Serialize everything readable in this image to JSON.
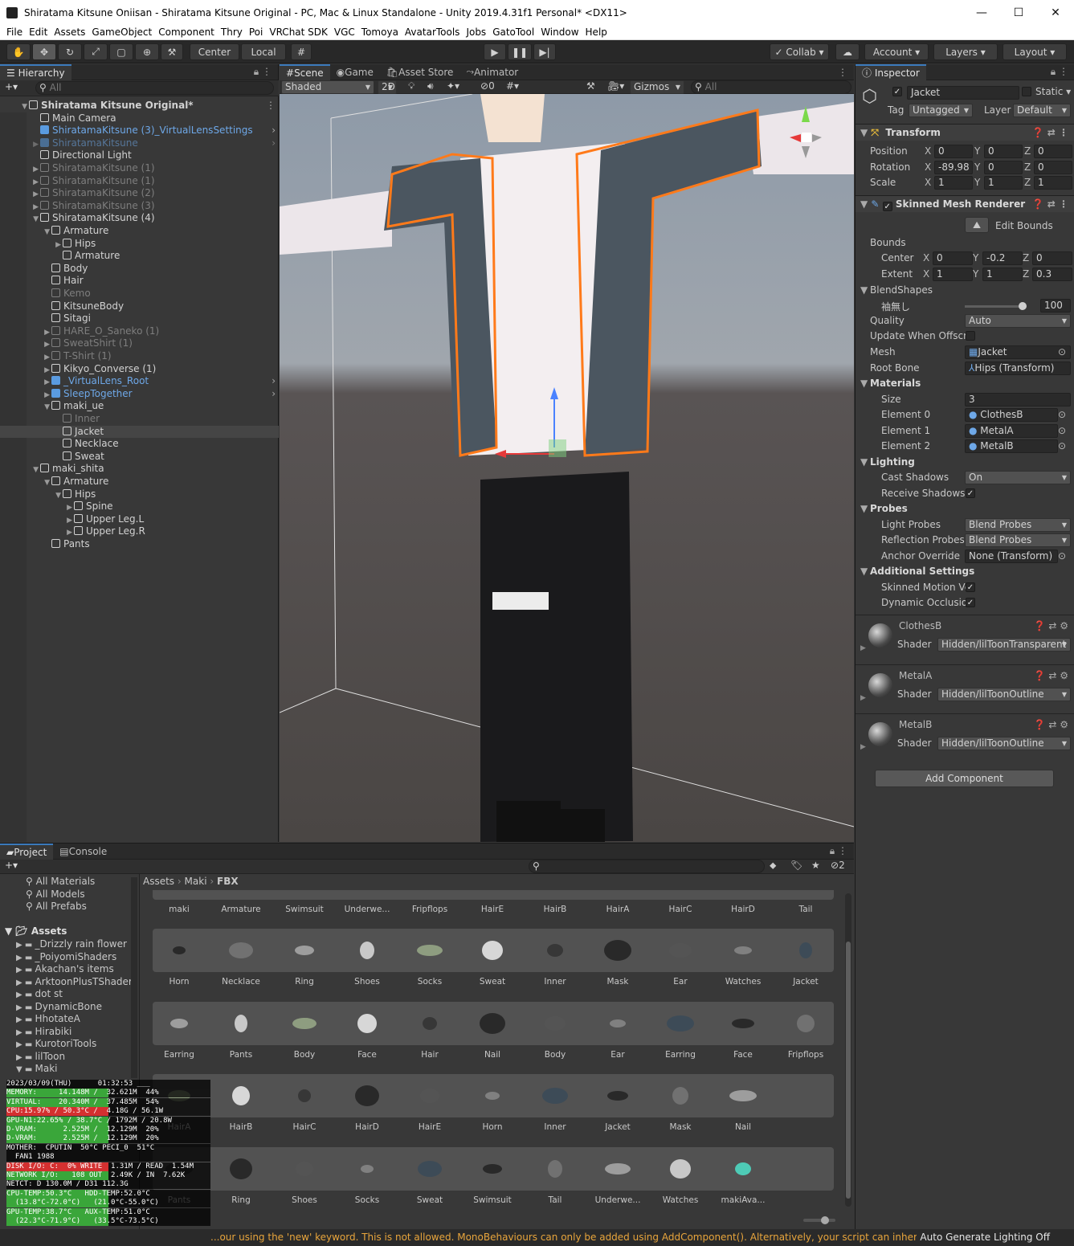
{
  "window": {
    "title": "Shiratama Kitsune Oniisan - Shiratama Kitsune Original - PC, Mac & Linux Standalone - Unity 2019.4.31f1 Personal* <DX11>"
  },
  "menu": [
    "File",
    "Edit",
    "Assets",
    "GameObject",
    "Component",
    "Thry",
    "Poi",
    "VRChat SDK",
    "VGC",
    "Tomoya",
    "AvatarTools",
    "Jobs",
    "GatoTool",
    "Window",
    "Help"
  ],
  "toolbar": {
    "pivot": "Center",
    "space": "Local",
    "collab": "Collab",
    "account": "Account",
    "layers": "Layers",
    "layout": "Layout"
  },
  "hierarchy": {
    "tab": "Hierarchy",
    "search": "All",
    "rows": [
      {
        "label": "Shiratama Kitsune Original*",
        "depth": 0,
        "arrow": "▼",
        "style": "root"
      },
      {
        "label": "Main Camera",
        "depth": 1,
        "arrow": "",
        "style": ""
      },
      {
        "label": "ShiratamaKitsune (3)_VirtualLensSettings",
        "depth": 1,
        "arrow": "",
        "style": "blue",
        "chev": true
      },
      {
        "label": "ShiratamaKitsune",
        "depth": 1,
        "arrow": "▶",
        "style": "grayblue",
        "chev": true
      },
      {
        "label": "Directional Light",
        "depth": 1,
        "arrow": "",
        "style": ""
      },
      {
        "label": "ShiratamaKitsune (1)",
        "depth": 1,
        "arrow": "▶",
        "style": "gray"
      },
      {
        "label": "ShiratamaKitsune (1)",
        "depth": 1,
        "arrow": "▶",
        "style": "gray"
      },
      {
        "label": "ShiratamaKitsune (2)",
        "depth": 1,
        "arrow": "▶",
        "style": "gray"
      },
      {
        "label": "ShiratamaKitsune (3)",
        "depth": 1,
        "arrow": "▶",
        "style": "gray"
      },
      {
        "label": "ShiratamaKitsune (4)",
        "depth": 1,
        "arrow": "▼",
        "style": ""
      },
      {
        "label": "Armature",
        "depth": 2,
        "arrow": "▼",
        "style": ""
      },
      {
        "label": "Hips",
        "depth": 3,
        "arrow": "▶",
        "style": ""
      },
      {
        "label": "Armature",
        "depth": 3,
        "arrow": "",
        "style": ""
      },
      {
        "label": "Body",
        "depth": 2,
        "arrow": "",
        "style": ""
      },
      {
        "label": "Hair",
        "depth": 2,
        "arrow": "",
        "style": ""
      },
      {
        "label": "Kemo",
        "depth": 2,
        "arrow": "",
        "style": "gray"
      },
      {
        "label": "KitsuneBody",
        "depth": 2,
        "arrow": "",
        "style": ""
      },
      {
        "label": "Sitagi",
        "depth": 2,
        "arrow": "",
        "style": ""
      },
      {
        "label": "HARE_O_Saneko (1)",
        "depth": 2,
        "arrow": "▶",
        "style": "gray"
      },
      {
        "label": "SweatShirt (1)",
        "depth": 2,
        "arrow": "▶",
        "style": "gray"
      },
      {
        "label": "T-Shirt (1)",
        "depth": 2,
        "arrow": "▶",
        "style": "gray"
      },
      {
        "label": "Kikyo_Converse (1)",
        "depth": 2,
        "arrow": "▶",
        "style": ""
      },
      {
        "label": "_VirtualLens_Root",
        "depth": 2,
        "arrow": "▶",
        "style": "blue",
        "chev": true
      },
      {
        "label": "SleepTogether",
        "depth": 2,
        "arrow": "▶",
        "style": "blue",
        "chev": true
      },
      {
        "label": "maki_ue",
        "depth": 2,
        "arrow": "▼",
        "style": ""
      },
      {
        "label": "Inner",
        "depth": 3,
        "arrow": "",
        "style": "gray"
      },
      {
        "label": "Jacket",
        "depth": 3,
        "arrow": "",
        "style": "sel"
      },
      {
        "label": "Necklace",
        "depth": 3,
        "arrow": "",
        "style": ""
      },
      {
        "label": "Sweat",
        "depth": 3,
        "arrow": "",
        "style": ""
      },
      {
        "label": "maki_shita",
        "depth": 1,
        "arrow": "▼",
        "style": ""
      },
      {
        "label": "Armature",
        "depth": 2,
        "arrow": "▼",
        "style": ""
      },
      {
        "label": "Hips",
        "depth": 3,
        "arrow": "▼",
        "style": ""
      },
      {
        "label": "Spine",
        "depth": 4,
        "arrow": "▶",
        "style": ""
      },
      {
        "label": "Upper Leg.L",
        "depth": 4,
        "arrow": "▶",
        "style": ""
      },
      {
        "label": "Upper Leg.R",
        "depth": 4,
        "arrow": "▶",
        "style": ""
      },
      {
        "label": "Pants",
        "depth": 2,
        "arrow": "",
        "style": ""
      }
    ]
  },
  "scene": {
    "tabs": [
      "Scene",
      "Game",
      "Asset Store",
      "Animator"
    ],
    "shading": "Shaded",
    "mode2d": "2D",
    "gizmos": "Gizmos",
    "search": "All",
    "hidden_count": "0"
  },
  "inspector": {
    "tab": "Inspector",
    "object_name": "Jacket",
    "static_label": "Static",
    "tag_label": "Tag",
    "tag": "Untagged",
    "layer_label": "Layer",
    "layer": "Default",
    "transform": {
      "title": "Transform",
      "rows": [
        {
          "label": "Position",
          "x": "0",
          "y": "0",
          "z": "0"
        },
        {
          "label": "Rotation",
          "x": "-89.98",
          "y": "0",
          "z": "0"
        },
        {
          "label": "Scale",
          "x": "1",
          "y": "1",
          "z": "1"
        }
      ]
    },
    "smr": {
      "title": "Skinned Mesh Renderer",
      "edit_bounds": "Edit Bounds",
      "bounds": "Bounds",
      "center": {
        "label": "Center",
        "x": "0",
        "y": "-0.2",
        "z": "0"
      },
      "extent": {
        "label": "Extent",
        "x": "1",
        "y": "1",
        "z": "0.3"
      },
      "blendshapes": "BlendShapes",
      "bs_name": "袖無し",
      "bs_value": "100",
      "bs_fraction": 1.0,
      "quality_label": "Quality",
      "quality": "Auto",
      "update_label": "Update When Offscre",
      "mesh_label": "Mesh",
      "mesh": "Jacket",
      "rootbone_label": "Root Bone",
      "rootbone": "Hips (Transform)",
      "materials": "Materials",
      "size_label": "Size",
      "size": "3",
      "elements": [
        {
          "label": "Element 0",
          "value": "ClothesB"
        },
        {
          "label": "Element 1",
          "value": "MetalA"
        },
        {
          "label": "Element 2",
          "value": "MetalB"
        }
      ],
      "lighting": "Lighting",
      "cast_label": "Cast Shadows",
      "cast": "On",
      "receive_label": "Receive Shadows",
      "probes": "Probes",
      "light_probes_label": "Light Probes",
      "light_probes": "Blend Probes",
      "refl_label": "Reflection Probes",
      "refl": "Blend Probes",
      "anchor_label": "Anchor Override",
      "anchor": "None (Transform)",
      "additional": "Additional Settings",
      "smv_label": "Skinned Motion Ve",
      "doc_label": "Dynamic Occlusio"
    },
    "shader_label": "Shader",
    "materials_list": [
      {
        "name": "ClothesB",
        "shader": "Hidden/lilToonTransparent"
      },
      {
        "name": "MetalA",
        "shader": "Hidden/lilToonOutline"
      },
      {
        "name": "MetalB",
        "shader": "Hidden/lilToonOutline"
      }
    ],
    "add_component": "Add Component"
  },
  "project": {
    "tabs": [
      "Project",
      "Console"
    ],
    "hidden_count": "2",
    "favorites": [
      "All Materials",
      "All Models",
      "All Prefabs"
    ],
    "assets_root": "Assets",
    "folders": [
      "_Drizzly rain flower",
      "_PoiyomiShaders",
      "Akachan's items",
      "ArktoonPlusTShader",
      "dot st",
      "DynamicBone",
      "HhotateA",
      "Hirabiki",
      "KurotoriTools",
      "lilToon",
      "Maki"
    ],
    "breadcrumb": [
      "Assets",
      "Maki",
      "FBX"
    ],
    "row0": [
      "maki",
      "Armature",
      "Swimsuit",
      "Underwe...",
      "Fripflops",
      "HairE",
      "HairB",
      "HairA",
      "HairC",
      "HairD",
      "Tail"
    ],
    "rows": [
      [
        "Horn",
        "Necklace",
        "Ring",
        "Shoes",
        "Socks",
        "Sweat",
        "Inner",
        "Mask",
        "Ear",
        "Watches",
        "Jacket"
      ],
      [
        "Earring",
        "Pants",
        "Body",
        "Face",
        "Hair",
        "Nail",
        "Body",
        "Ear",
        "Earring",
        "Face",
        "Fripflops"
      ],
      [
        "HairA",
        "HairB",
        "HairC",
        "HairD",
        "HairE",
        "Horn",
        "Inner",
        "Jacket",
        "Mask",
        "Nail"
      ],
      [
        "Pants",
        "Ring",
        "Shoes",
        "Socks",
        "Sweat",
        "Swimsuit",
        "Tail",
        "Underwe...",
        "Watches",
        "makiAva..."
      ]
    ]
  },
  "overlay": [
    "2023/03/09(THU)      01:32:53 ___",
    "MEMORY:     14.148M /  32.621M  44%",
    "VIRTUAL:    20.340M /  37.485M  54%",
    "CPU:15.97% / 50.3°C /  4.18G / 56.1W",
    "GPU-N1:22.65% / 38.7°C / 1792M / 20.8W",
    "D-VRAM:      2.525M /  12.129M  20%",
    "D-VRAM:      2.525M /  12.129M  20%",
    "MOTHER:  CPUTIN  50°C PECI_0  51°C",
    "  FAN1 1988",
    "DISK I/O: C:  0% WRITE  1.31M / READ  1.54M",
    "NETWORK I/O:   108 OUT  2.49K / IN  7.62K",
    "NETCT: D 130.0M / D31 112.3G",
    "CPU-TEMP:50.3°C   HDD-TEMP:52.0°C",
    "  (13.8°C-72.0°C)   (21.0°C-55.0°C)",
    "GPU-TEMP:38.7°C   AUX-TEMP:51.0°C",
    "  (22.3°C-71.9°C)   (33.5°C-73.5°C)"
  ],
  "status": {
    "message": "...our using the 'new' keyword.  This is not allowed.  MonoBehaviours can only be added using AddComponent(). Alternatively, your script can inherit from ScriptableObject or",
    "lighting": "Auto Generate Lighting Off"
  },
  "colors": {
    "selection": "#e8640a",
    "accent": "#3a79bb",
    "panel": "#383838"
  }
}
